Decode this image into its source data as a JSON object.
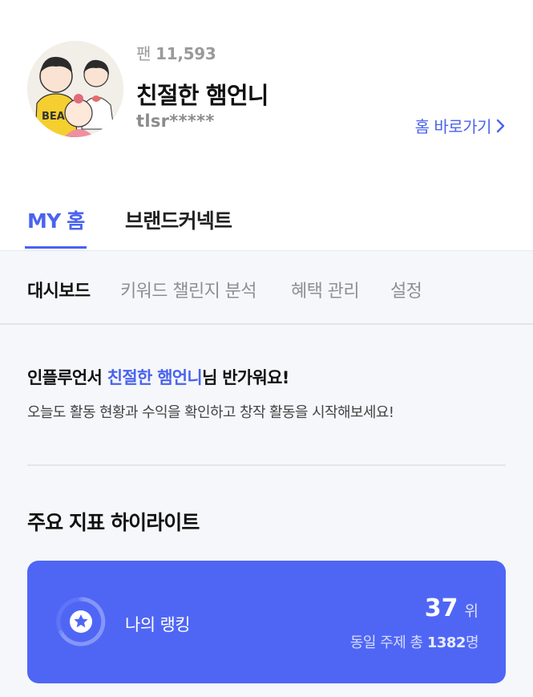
{
  "profile": {
    "fans_label": "팬",
    "fans_count": "11,593",
    "name": "친절한 햄언니",
    "id": "tlsr*****",
    "home_link": "홈 바로가기"
  },
  "tabs": [
    {
      "label": "MY 홈",
      "active": true
    },
    {
      "label": "브랜드커넥트",
      "active": false
    }
  ],
  "subnav": [
    {
      "label": "대시보드",
      "active": true
    },
    {
      "label": "키워드 챌린지 분석",
      "active": false
    },
    {
      "label": "혜택 관리",
      "active": false
    },
    {
      "label": "설정",
      "active": false
    }
  ],
  "welcome": {
    "prefix": "인플루언서 ",
    "name": "친절한 햄언니",
    "suffix": "님 반가워요!",
    "subtitle": "오늘도 활동 현황과 수익을 확인하고 창작 활동을 시작해보세요!"
  },
  "highlights": {
    "title": "주요 지표 하이라이트",
    "ranking": {
      "label": "나의 랭킹",
      "rank": "37",
      "rank_unit": "위",
      "total_prefix": "동일 주제 총",
      "total_count": "1382",
      "total_unit": "명"
    }
  },
  "colors": {
    "accent": "#4a63ee",
    "card": "#4f66f5"
  },
  "icons": {
    "home_link_arrow": "chevron-right-icon",
    "ranking": "star-badge-icon"
  }
}
